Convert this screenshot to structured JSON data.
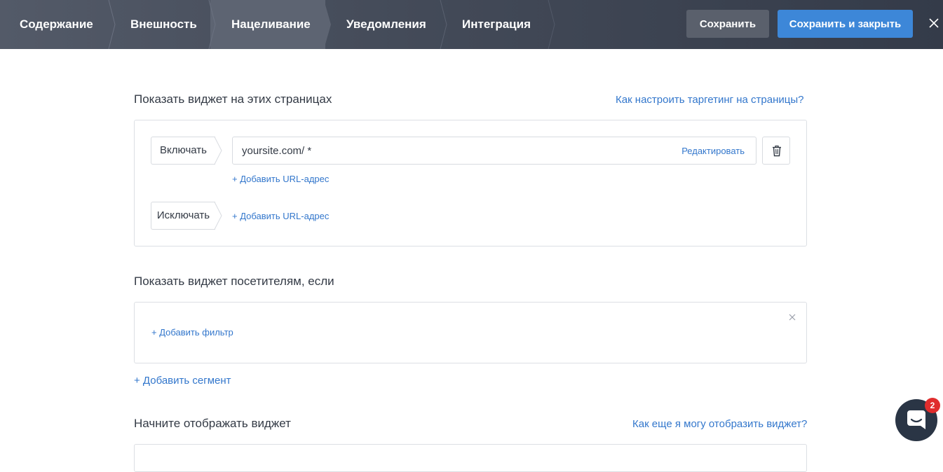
{
  "steps": [
    {
      "label": "Содержание",
      "active": false
    },
    {
      "label": "Внешность",
      "active": false
    },
    {
      "label": "Нацеливание",
      "active": true
    },
    {
      "label": "Уведомления",
      "active": false
    },
    {
      "label": "Интеграция",
      "active": false
    }
  ],
  "toolbar": {
    "save_label": "Сохранить",
    "save_close_label": "Сохранить и закрыть",
    "close_icon": "close-icon"
  },
  "pages_section": {
    "title": "Показать виджет на этих страницах",
    "help_link": "Как настроить таргетинг на страницы?",
    "include": {
      "label": "Включать",
      "url": "yoursite.com/ *",
      "edit_label": "Редактировать",
      "delete_icon": "trash-icon",
      "add_url": "+ Добавить URL-адрес"
    },
    "exclude": {
      "label": "Исключать",
      "add_url": "+ Добавить URL-адрес"
    }
  },
  "visitors_section": {
    "title": "Показать виджет посетителям, если",
    "add_filter": "+ Добавить фильтр",
    "add_segment": "+ Добавить сегмент"
  },
  "display_section": {
    "title": "Начните отображать виджет",
    "help_link": "Как еще я могу отобразить виджет?"
  },
  "chat": {
    "badge_count": "2",
    "icon": "chat-icon"
  },
  "colors": {
    "accent": "#3d87d8",
    "link": "#3377cc",
    "topbar": "#434a58",
    "badge": "#e02d2d"
  }
}
